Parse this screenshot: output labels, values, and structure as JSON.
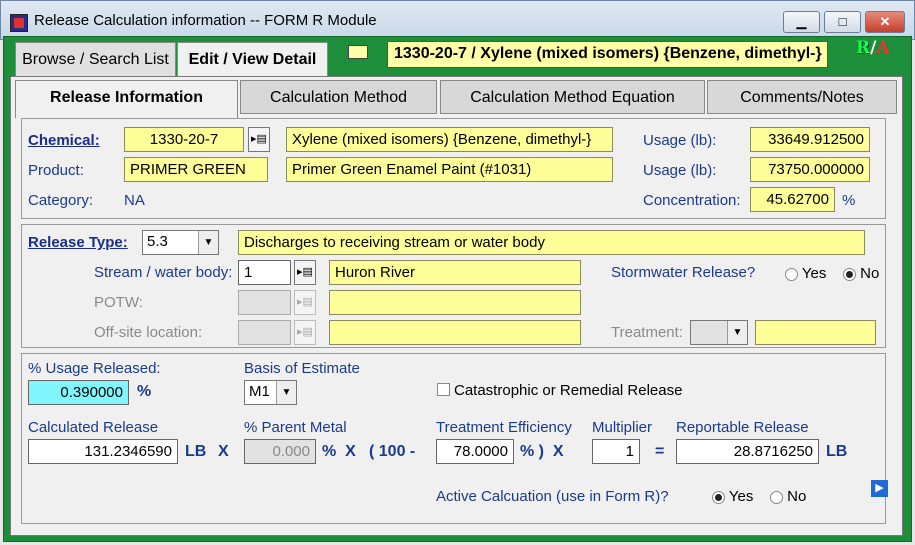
{
  "window": {
    "title": "Release Calculation information -- FORM R Module",
    "min": "▁",
    "max": "□",
    "close": "✕"
  },
  "outer_tabs": {
    "browse": "Browse / Search List",
    "edit": "Edit / View Detail"
  },
  "header": {
    "chemical": "1330-20-7 / Xylene (mixed isomers)  {Benzene, dimethyl-}",
    "logo_r": "R",
    "logo_sep": "/",
    "logo_a": "A"
  },
  "inner_tabs": {
    "release": "Release Information",
    "calc_method": "Calculation Method",
    "calc_eq": "Calculation Method Equation",
    "comments": "Comments/Notes"
  },
  "chemical": {
    "label": "Chemical:",
    "cas": "1330-20-7",
    "name": "Xylene (mixed isomers)  {Benzene, dimethyl-}",
    "usage_label": "Usage (lb):",
    "usage": "33649.912500",
    "product_label": "Product:",
    "product": "PRIMER GREEN",
    "product_name": "Primer Green Enamel Paint (#1031)",
    "usage2_label": "Usage (lb):",
    "usage2": "73750.000000",
    "category_label": "Category:",
    "category": "NA",
    "conc_label": "Concentration:",
    "conc": "45.62700",
    "conc_unit": "%"
  },
  "release": {
    "type_label": "Release Type:",
    "type": "5.3",
    "type_desc": "Discharges to receiving stream or water body",
    "stream_label": "Stream / water body:",
    "stream_no": "1",
    "stream_name": "Huron River",
    "storm_label": "Stormwater Release?",
    "storm_yes": "Yes",
    "storm_no": "No",
    "storm_value": "No",
    "potw_label": "POTW:",
    "offsite_label": "Off-site location:",
    "treatment_label": "Treatment:"
  },
  "calc": {
    "pct_label": "% Usage Released:",
    "pct": "0.390000",
    "pct_unit": "%",
    "basis_label": "Basis of Estimate",
    "basis": "M1",
    "catastrophic_label": "Catastrophic or Remedial Release",
    "calc_label": "Calculated Release",
    "calc_value": "131.2346590",
    "lb1": "LB",
    "x1": "X",
    "parent_label": "% Parent Metal",
    "parent": "0.000",
    "pct_x": "%  X",
    "paren": "( 100 -",
    "eff_label": "Treatment Efficiency",
    "eff": "78.0000",
    "eff_close": "% )  X",
    "mult_label": "Multiplier",
    "mult": "1",
    "eq": "=",
    "rep_label": "Reportable Release",
    "rep": "28.8716250",
    "lb2": "LB",
    "active_label": "Active Calcuation (use in Form R)?",
    "active_yes": "Yes",
    "active_no": "No",
    "active_value": "Yes"
  },
  "icons": {
    "browse": "▸▤",
    "nav": "▶",
    "dropdown": "▼"
  }
}
